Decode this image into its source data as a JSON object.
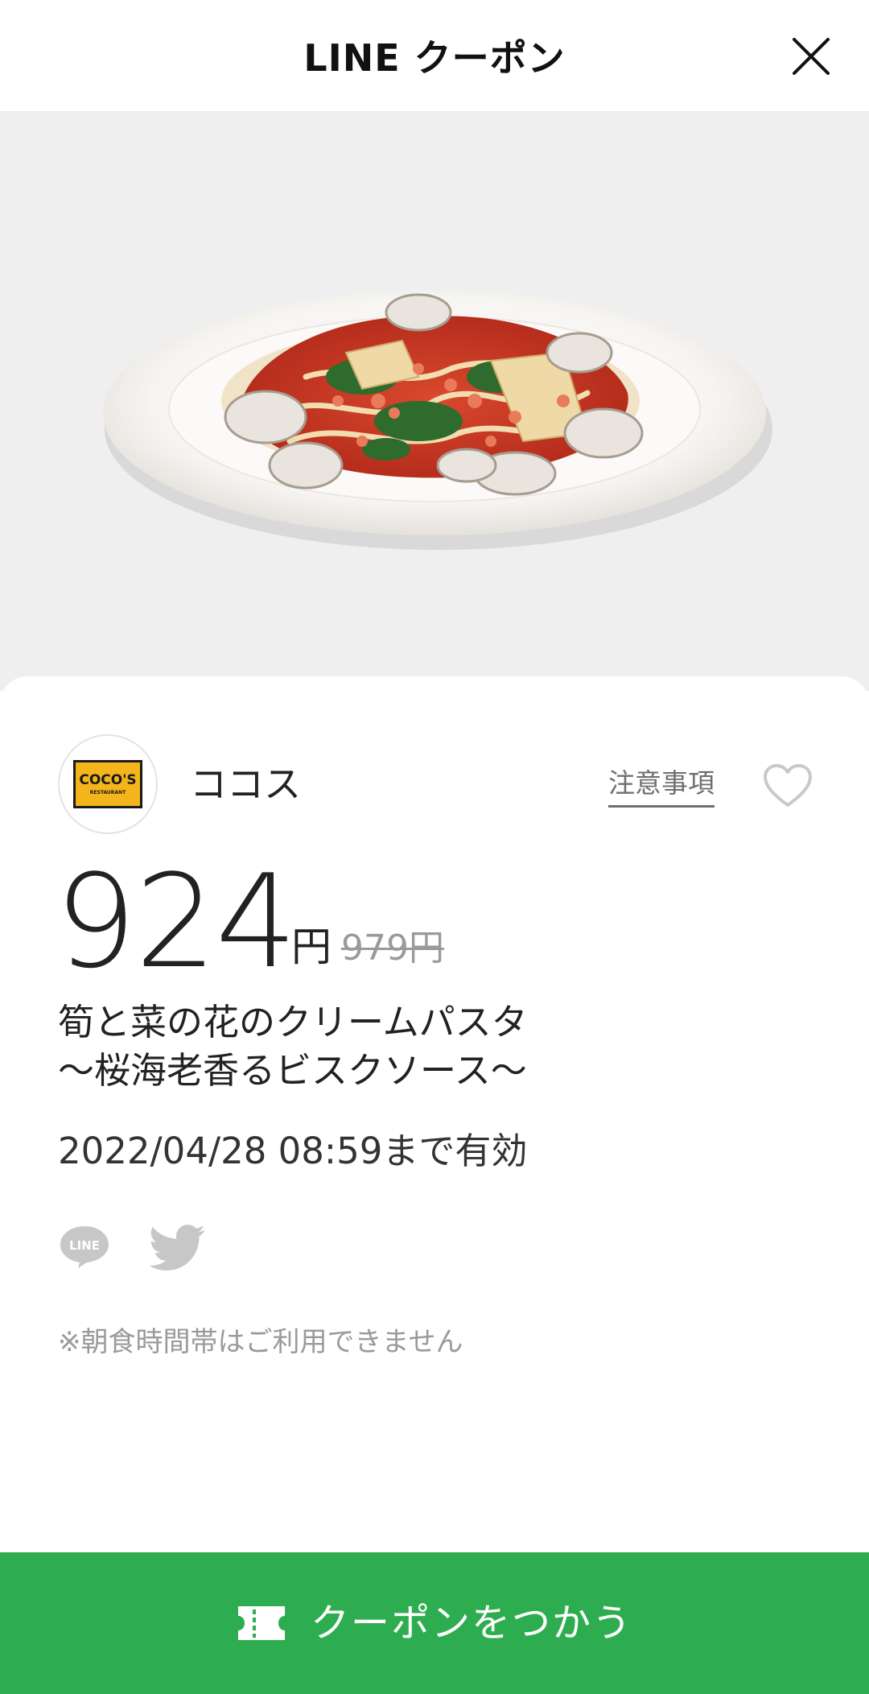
{
  "header": {
    "title": "LINE クーポン",
    "close_icon": "close-icon"
  },
  "hero": {
    "image_subject": "plate of cream pasta with clams, sakura shrimp, bamboo shoots and rape blossoms",
    "background_color": "#efefef"
  },
  "store": {
    "logo_text": "COCO'S",
    "logo_subtext": "RESTAURANT",
    "logo_color": "#f4b51c",
    "name": "ココス",
    "notice_link": "注意事項",
    "favorite_icon": "heart-outline-icon"
  },
  "price": {
    "current": "924",
    "unit": "円",
    "original": "979円"
  },
  "item": {
    "name_line1": "筍と菜の花のクリームパスタ",
    "name_line2": "〜桜海老香るビスクソース〜"
  },
  "validity": "2022/04/28  08:59まで有効",
  "share": {
    "line_icon": "line-share-icon",
    "twitter_icon": "twitter-icon"
  },
  "note": "※朝食時間帯はご利用できません",
  "cta": {
    "label": "クーポンをつかう",
    "icon": "ticket-icon",
    "color": "#2ead50"
  }
}
